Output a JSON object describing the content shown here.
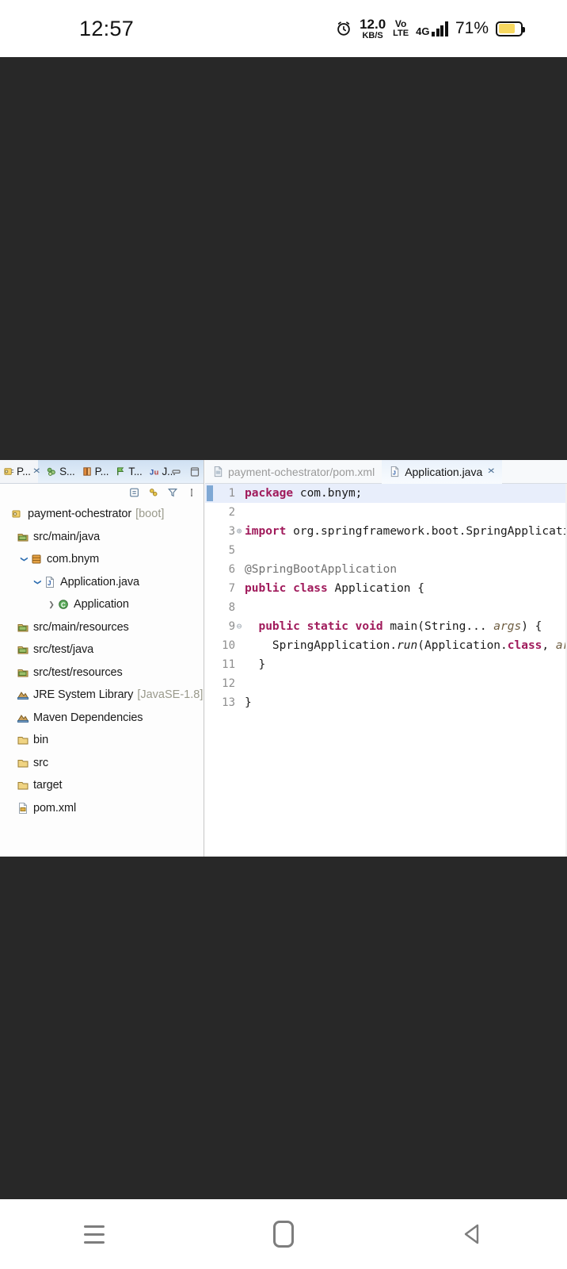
{
  "status_bar": {
    "time": "12:57",
    "alarm_icon": "alarm-clock-icon",
    "net_speed_value": "12.0",
    "net_speed_unit": "KB/S",
    "volte_top": "Vo",
    "volte_bottom": "LTE",
    "network_type": "4G",
    "signal_icon": "signal-bars-icon",
    "battery_percent": "71%",
    "battery_icon": "battery-icon",
    "accent_battery": "#f7d860"
  },
  "eclipse": {
    "left_view": {
      "tabs": [
        {
          "label": "P...",
          "icon": "package-explorer-icon",
          "selected": true,
          "closable": true
        },
        {
          "label": "S...",
          "icon": "servers-icon",
          "selected": false,
          "closable": false
        },
        {
          "label": "P...",
          "icon": "project-explorer-icon",
          "selected": false,
          "closable": false
        },
        {
          "label": "T...",
          "icon": "task-list-icon",
          "selected": false,
          "closable": false
        },
        {
          "label": "J...",
          "icon": "junit-icon",
          "selected": false,
          "closable": false
        }
      ],
      "window_controls": [
        "minimize-icon",
        "maximize-icon"
      ],
      "toolbar_icons": [
        "collapse-all-icon",
        "link-with-editor-icon",
        "filter-icon",
        "view-menu-icon"
      ],
      "tree": [
        {
          "label": "payment-ochestrator",
          "suffix": "[boot]",
          "icon": "project-icon",
          "indent": 0,
          "twisty": ""
        },
        {
          "label": "src/main/java",
          "suffix": "",
          "icon": "source-folder-icon",
          "indent": 1,
          "twisty": ""
        },
        {
          "label": "com.bnym",
          "suffix": "",
          "icon": "package-icon",
          "indent": 2,
          "twisty": "down"
        },
        {
          "label": "Application.java",
          "suffix": "",
          "icon": "java-file-icon",
          "indent": 3,
          "twisty": "down"
        },
        {
          "label": "Application",
          "suffix": "",
          "icon": "java-class-icon",
          "indent": 4,
          "twisty": "right"
        },
        {
          "label": "src/main/resources",
          "suffix": "",
          "icon": "source-folder-icon",
          "indent": 1,
          "twisty": ""
        },
        {
          "label": "src/test/java",
          "suffix": "",
          "icon": "source-folder-icon",
          "indent": 1,
          "twisty": ""
        },
        {
          "label": "src/test/resources",
          "suffix": "",
          "icon": "source-folder-icon",
          "indent": 1,
          "twisty": ""
        },
        {
          "label": "JRE System Library",
          "suffix": "[JavaSE-1.8]",
          "icon": "library-icon",
          "indent": 1,
          "twisty": ""
        },
        {
          "label": "Maven Dependencies",
          "suffix": "",
          "icon": "library-icon",
          "indent": 1,
          "twisty": ""
        },
        {
          "label": "bin",
          "suffix": "",
          "icon": "folder-icon",
          "indent": 1,
          "twisty": ""
        },
        {
          "label": "src",
          "suffix": "",
          "icon": "folder-icon",
          "indent": 1,
          "twisty": ""
        },
        {
          "label": "target",
          "suffix": "",
          "icon": "folder-icon",
          "indent": 1,
          "twisty": ""
        },
        {
          "label": "pom.xml",
          "suffix": "",
          "icon": "xml-file-icon",
          "indent": 1,
          "twisty": ""
        }
      ]
    },
    "editor": {
      "tabs": [
        {
          "label": "payment-ochestrator/pom.xml",
          "icon": "xml-file-icon",
          "active": false,
          "close": ""
        },
        {
          "label": "Application.java",
          "icon": "java-file-icon",
          "active": true,
          "close": "✕"
        }
      ],
      "file_name": "Application.java",
      "lines": [
        {
          "num": "1",
          "fold": "",
          "highlight": true,
          "cursor": true,
          "segments": [
            {
              "t": "package",
              "c": "kw"
            },
            {
              "t": " com.bnym;",
              "c": "pl"
            }
          ]
        },
        {
          "num": "2",
          "fold": "",
          "highlight": false,
          "cursor": false,
          "segments": []
        },
        {
          "num": "3",
          "fold": "⊕",
          "highlight": false,
          "cursor": false,
          "segments": [
            {
              "t": "import",
              "c": "kw"
            },
            {
              "t": " org.springframework.boot.SpringApplication;",
              "c": "pl"
            }
          ],
          "trailing_box": true
        },
        {
          "num": "5",
          "fold": "",
          "highlight": false,
          "cursor": false,
          "segments": []
        },
        {
          "num": "6",
          "fold": "",
          "highlight": false,
          "cursor": false,
          "segments": [
            {
              "t": "@SpringBootApplication",
              "c": "ann"
            }
          ]
        },
        {
          "num": "7",
          "fold": "",
          "highlight": false,
          "cursor": false,
          "segments": [
            {
              "t": "public class",
              "c": "kw"
            },
            {
              "t": " Application {",
              "c": "pl"
            }
          ]
        },
        {
          "num": "8",
          "fold": "",
          "highlight": false,
          "cursor": false,
          "segments": []
        },
        {
          "num": "9",
          "fold": "⊖",
          "highlight": false,
          "cursor": false,
          "segments": [
            {
              "t": "  ",
              "c": "pl"
            },
            {
              "t": "public static void",
              "c": "kw"
            },
            {
              "t": " main(String... ",
              "c": "pl"
            },
            {
              "t": "args",
              "c": "par"
            },
            {
              "t": ") {",
              "c": "pl"
            }
          ]
        },
        {
          "num": "10",
          "fold": "",
          "highlight": false,
          "cursor": false,
          "segments": [
            {
              "t": "    SpringApplication.",
              "c": "pl"
            },
            {
              "t": "run",
              "c": "it"
            },
            {
              "t": "(Application.",
              "c": "pl"
            },
            {
              "t": "class",
              "c": "kw"
            },
            {
              "t": ", ",
              "c": "pl"
            },
            {
              "t": "args",
              "c": "par"
            },
            {
              "t": ");",
              "c": "pl"
            }
          ]
        },
        {
          "num": "11",
          "fold": "",
          "highlight": false,
          "cursor": false,
          "segments": [
            {
              "t": "  }",
              "c": "pl"
            }
          ]
        },
        {
          "num": "12",
          "fold": "",
          "highlight": false,
          "cursor": false,
          "segments": []
        },
        {
          "num": "13",
          "fold": "",
          "highlight": false,
          "cursor": false,
          "segments": [
            {
              "t": "}",
              "c": "pl"
            }
          ]
        }
      ]
    }
  },
  "navbar": {
    "recents_label": "recent-apps",
    "home_label": "home",
    "back_label": "back"
  }
}
